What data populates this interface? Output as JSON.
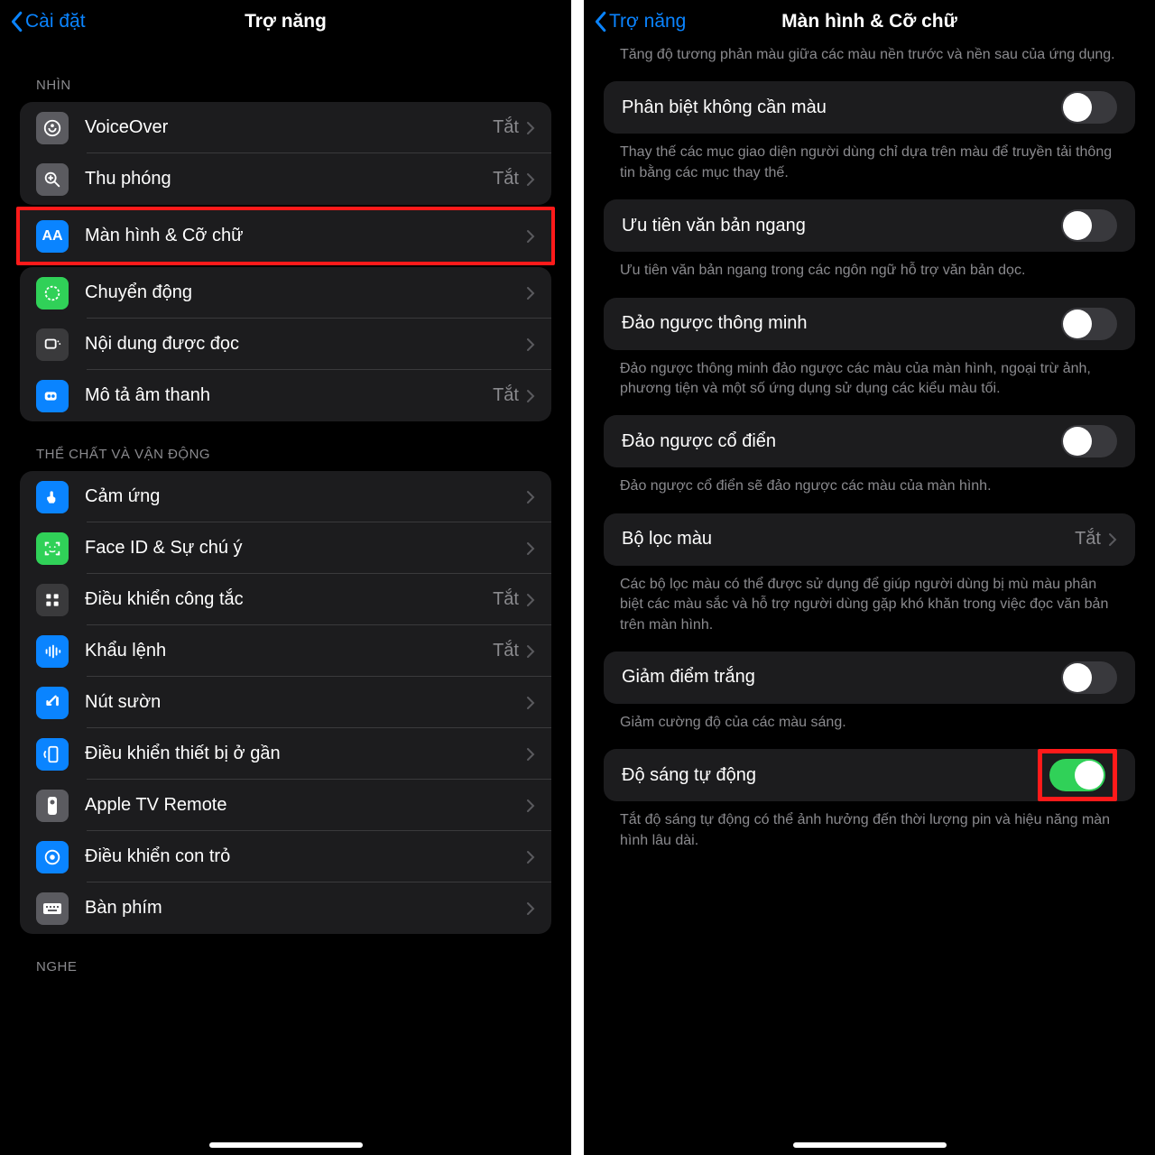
{
  "left": {
    "back": "Cài đặt",
    "title": "Trợ năng",
    "sections": {
      "see": "NHÌN",
      "physical": "THỂ CHẤT VÀ VẬN ĐỘNG",
      "hear": "NGHE"
    },
    "items": {
      "voiceover": {
        "label": "VoiceOver",
        "value": "Tắt"
      },
      "zoom": {
        "label": "Thu phóng",
        "value": "Tắt"
      },
      "display": {
        "label": "Màn hình & Cỡ chữ"
      },
      "motion": {
        "label": "Chuyển động"
      },
      "spoken": {
        "label": "Nội dung được đọc"
      },
      "audiodesc": {
        "label": "Mô tả âm thanh",
        "value": "Tắt"
      },
      "touch": {
        "label": "Cảm ứng"
      },
      "faceid": {
        "label": "Face ID & Sự chú ý"
      },
      "switch": {
        "label": "Điều khiển công tắc",
        "value": "Tắt"
      },
      "voicectl": {
        "label": "Khẩu lệnh",
        "value": "Tắt"
      },
      "sidebtn": {
        "label": "Nút sườn"
      },
      "nearby": {
        "label": "Điều khiển thiết bị ở gần"
      },
      "appletv": {
        "label": "Apple TV Remote"
      },
      "pointer": {
        "label": "Điều khiển con trỏ"
      },
      "keyboard": {
        "label": "Bàn phím"
      }
    }
  },
  "right": {
    "back": "Trợ năng",
    "title": "Màn hình & Cỡ chữ",
    "intro": "Tăng độ tương phản màu giữa các màu nền trước và nền sau của ứng dụng.",
    "items": {
      "diffnocolor": {
        "label": "Phân biệt không cần màu",
        "desc": "Thay thế các mục giao diện người dùng chỉ dựa trên màu để truyền tải thông tin bằng các mục thay thế."
      },
      "horiz": {
        "label": "Ưu tiên văn bản ngang",
        "desc": "Ưu tiên văn bản ngang trong các ngôn ngữ hỗ trợ văn bản dọc."
      },
      "smartinv": {
        "label": "Đảo ngược thông minh",
        "desc": "Đảo ngược thông minh đảo ngược các màu của màn hình, ngoại trừ ảnh, phương tiện và một số ứng dụng sử dụng các kiểu màu tối."
      },
      "classicinv": {
        "label": "Đảo ngược cổ điển",
        "desc": "Đảo ngược cổ điển sẽ đảo ngược các màu của màn hình."
      },
      "colorfilter": {
        "label": "Bộ lọc màu",
        "value": "Tắt",
        "desc": "Các bộ lọc màu có thể được sử dụng để giúp người dùng bị mù màu phân biệt các màu sắc và hỗ trợ người dùng gặp khó khăn trong việc đọc văn bản trên màn hình."
      },
      "whitepoint": {
        "label": "Giảm điểm trắng",
        "desc": "Giảm cường độ của các màu sáng."
      },
      "autobright": {
        "label": "Độ sáng tự động",
        "desc": "Tắt độ sáng tự động có thể ảnh hưởng đến thời lượng pin và hiệu năng màn hình lâu dài."
      }
    }
  }
}
